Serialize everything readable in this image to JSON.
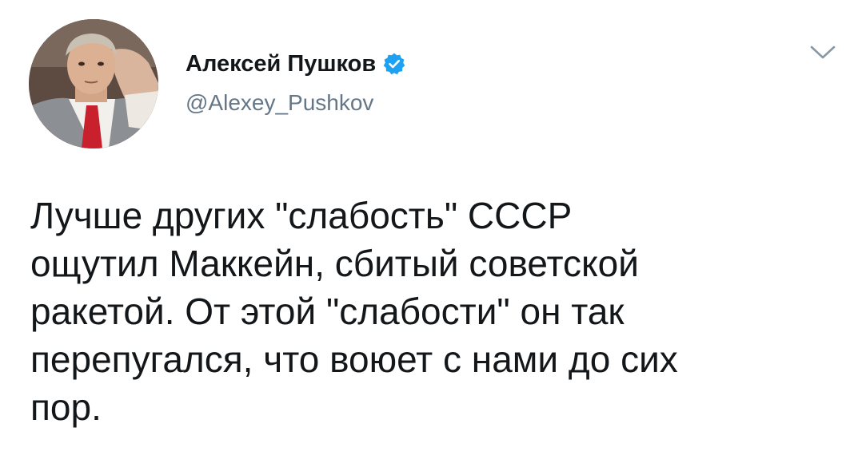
{
  "author": {
    "display_name": "Алексей Пушков",
    "handle": "@Alexey_Pushkov",
    "verified": true,
    "avatar_icon": "profile-photo"
  },
  "tweet": {
    "text": "Лучше других \"слабость\" СССР\nощутил Маккейн, сбитый советской\nракетой. От этой \"слабости\" он так\nперепугался, что воюет с нами до сих\nпор."
  },
  "icons": {
    "verified": "verified-badge-icon",
    "menu": "chevron-down-icon"
  },
  "colors": {
    "verified_blue": "#1da1f2",
    "handle_gray": "#657786",
    "text_dark": "#14171a",
    "caret_gray": "#8899a6"
  }
}
